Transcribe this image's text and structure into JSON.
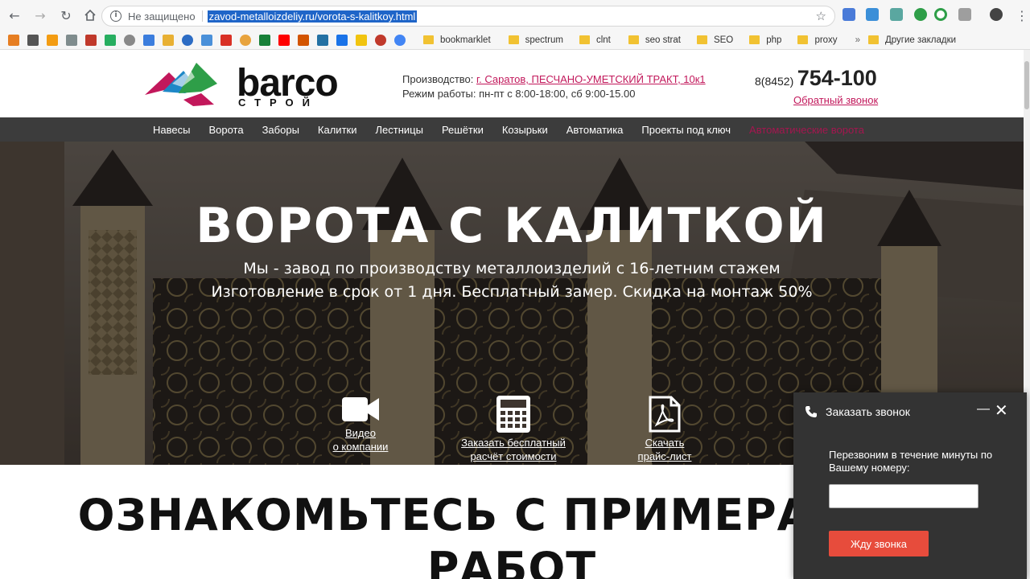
{
  "browser": {
    "security_label": "Не защищено",
    "url": "zavod-metalloizdeliy.ru/vorota-s-kalitkoy.html",
    "bookmarks": [
      "bookmarklet",
      "spectrum",
      "clnt",
      "seo strat",
      "SEO",
      "php",
      "proxy"
    ],
    "other_bookmarks": "Другие закладки"
  },
  "header": {
    "logo_main": "barco",
    "logo_sub": "строй",
    "production_label": "Производство:",
    "production_address": "г. Саратов, ПЕСЧАНО-УМЕТСКИЙ ТРАКТ, 10к1",
    "hours": "Режим работы: пн-пт с 8:00-18:00, сб 9:00-15.00",
    "phone_code": "8(8452)",
    "phone_number": "754-100",
    "callback_link": "Обратный звонок"
  },
  "menu": {
    "items": [
      "Навесы",
      "Ворота",
      "Заборы",
      "Калитки",
      "Лестницы",
      "Решётки",
      "Козырьки",
      "Автоматика",
      "Проекты под ключ",
      "Автоматические ворота"
    ]
  },
  "hero": {
    "title": "ВОРОТА С КАЛИТКОЙ",
    "subtitle_line1": "Мы - завод по производству металлоизделий с 16-летним стажем",
    "subtitle_line2": "Изготовление в срок от 1 дня. Бесплатный замер. Скидка на монтаж 50%",
    "actions": [
      {
        "line1": "Видео",
        "line2": "о компании",
        "icon": "video-camera-icon"
      },
      {
        "line1": "Заказать бесплатный",
        "line2": "расчёт стоимости",
        "icon": "calculator-icon"
      },
      {
        "line1": "Скачать",
        "line2": "прайс-лист",
        "icon": "pdf-icon"
      }
    ]
  },
  "section": {
    "title_line1": "ОЗНАКОМЬТЕСЬ С ПРИМЕРАМИ Н",
    "title_line2": "РАБОТ"
  },
  "widget": {
    "title": "Заказать звонок",
    "text": "Перезвоним в течение минуты по Вашему номеру:",
    "button": "Жду звонка"
  },
  "colors": {
    "accent": "#c2185b",
    "menu_bg": "#3c3c3c",
    "widget_bg": "#333333",
    "widget_button": "#e74c3c",
    "url_highlight": "#1f65c8"
  }
}
